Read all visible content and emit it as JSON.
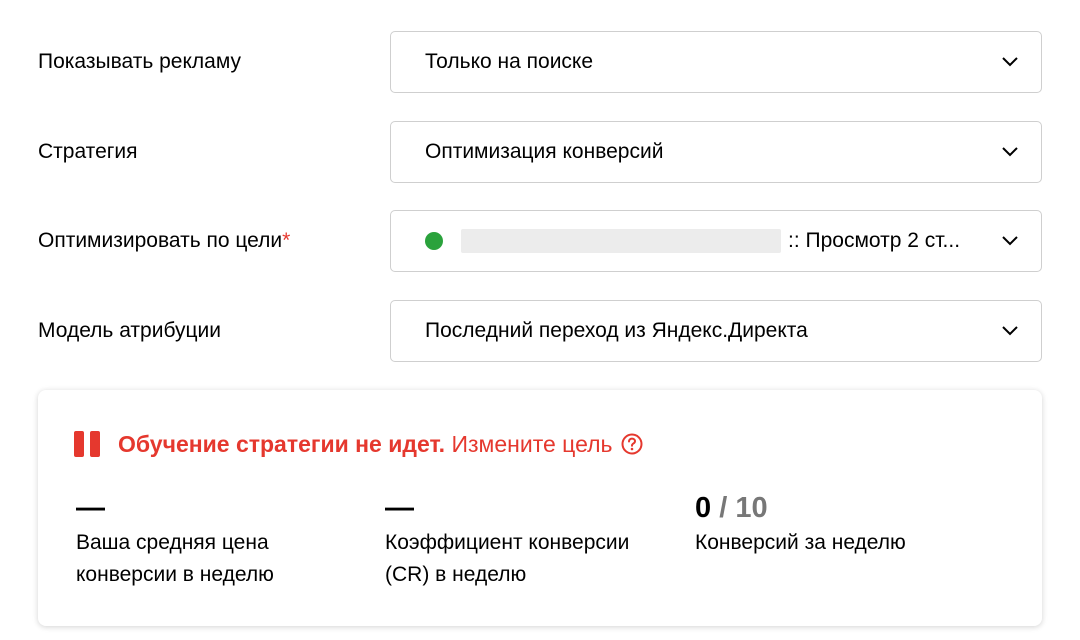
{
  "fields": {
    "show_ads": {
      "label": "Показывать рекламу",
      "value": "Только на поиске"
    },
    "strategy": {
      "label": "Стратегия",
      "value": "Оптимизация конверсий"
    },
    "goal": {
      "label": "Оптимизировать по цели",
      "required_mark": "*",
      "value_suffix": ":: Просмотр 2 ст...",
      "status_color": "#2aa23c"
    },
    "attribution": {
      "label": "Модель атрибуции",
      "value": "Последний переход из Яндекс.Директа"
    }
  },
  "learning_card": {
    "status_icon": "pause-icon",
    "status_bold": "Обучение стратегии не идет.",
    "status_link": "Измените цель",
    "help_icon": "question-circle-icon",
    "accent_color": "#e5382e",
    "metrics": [
      {
        "value": "—",
        "label_line1": "Ваша средняя цена",
        "label_line2": "конверсии в неделю"
      },
      {
        "value": "—",
        "label_line1": "Коэффициент конверсии",
        "label_line2": "(CR) в неделю"
      },
      {
        "value_current": "0",
        "value_separator": "/ 10",
        "label_line1": "Конверсий за неделю",
        "label_line2": ""
      }
    ]
  }
}
